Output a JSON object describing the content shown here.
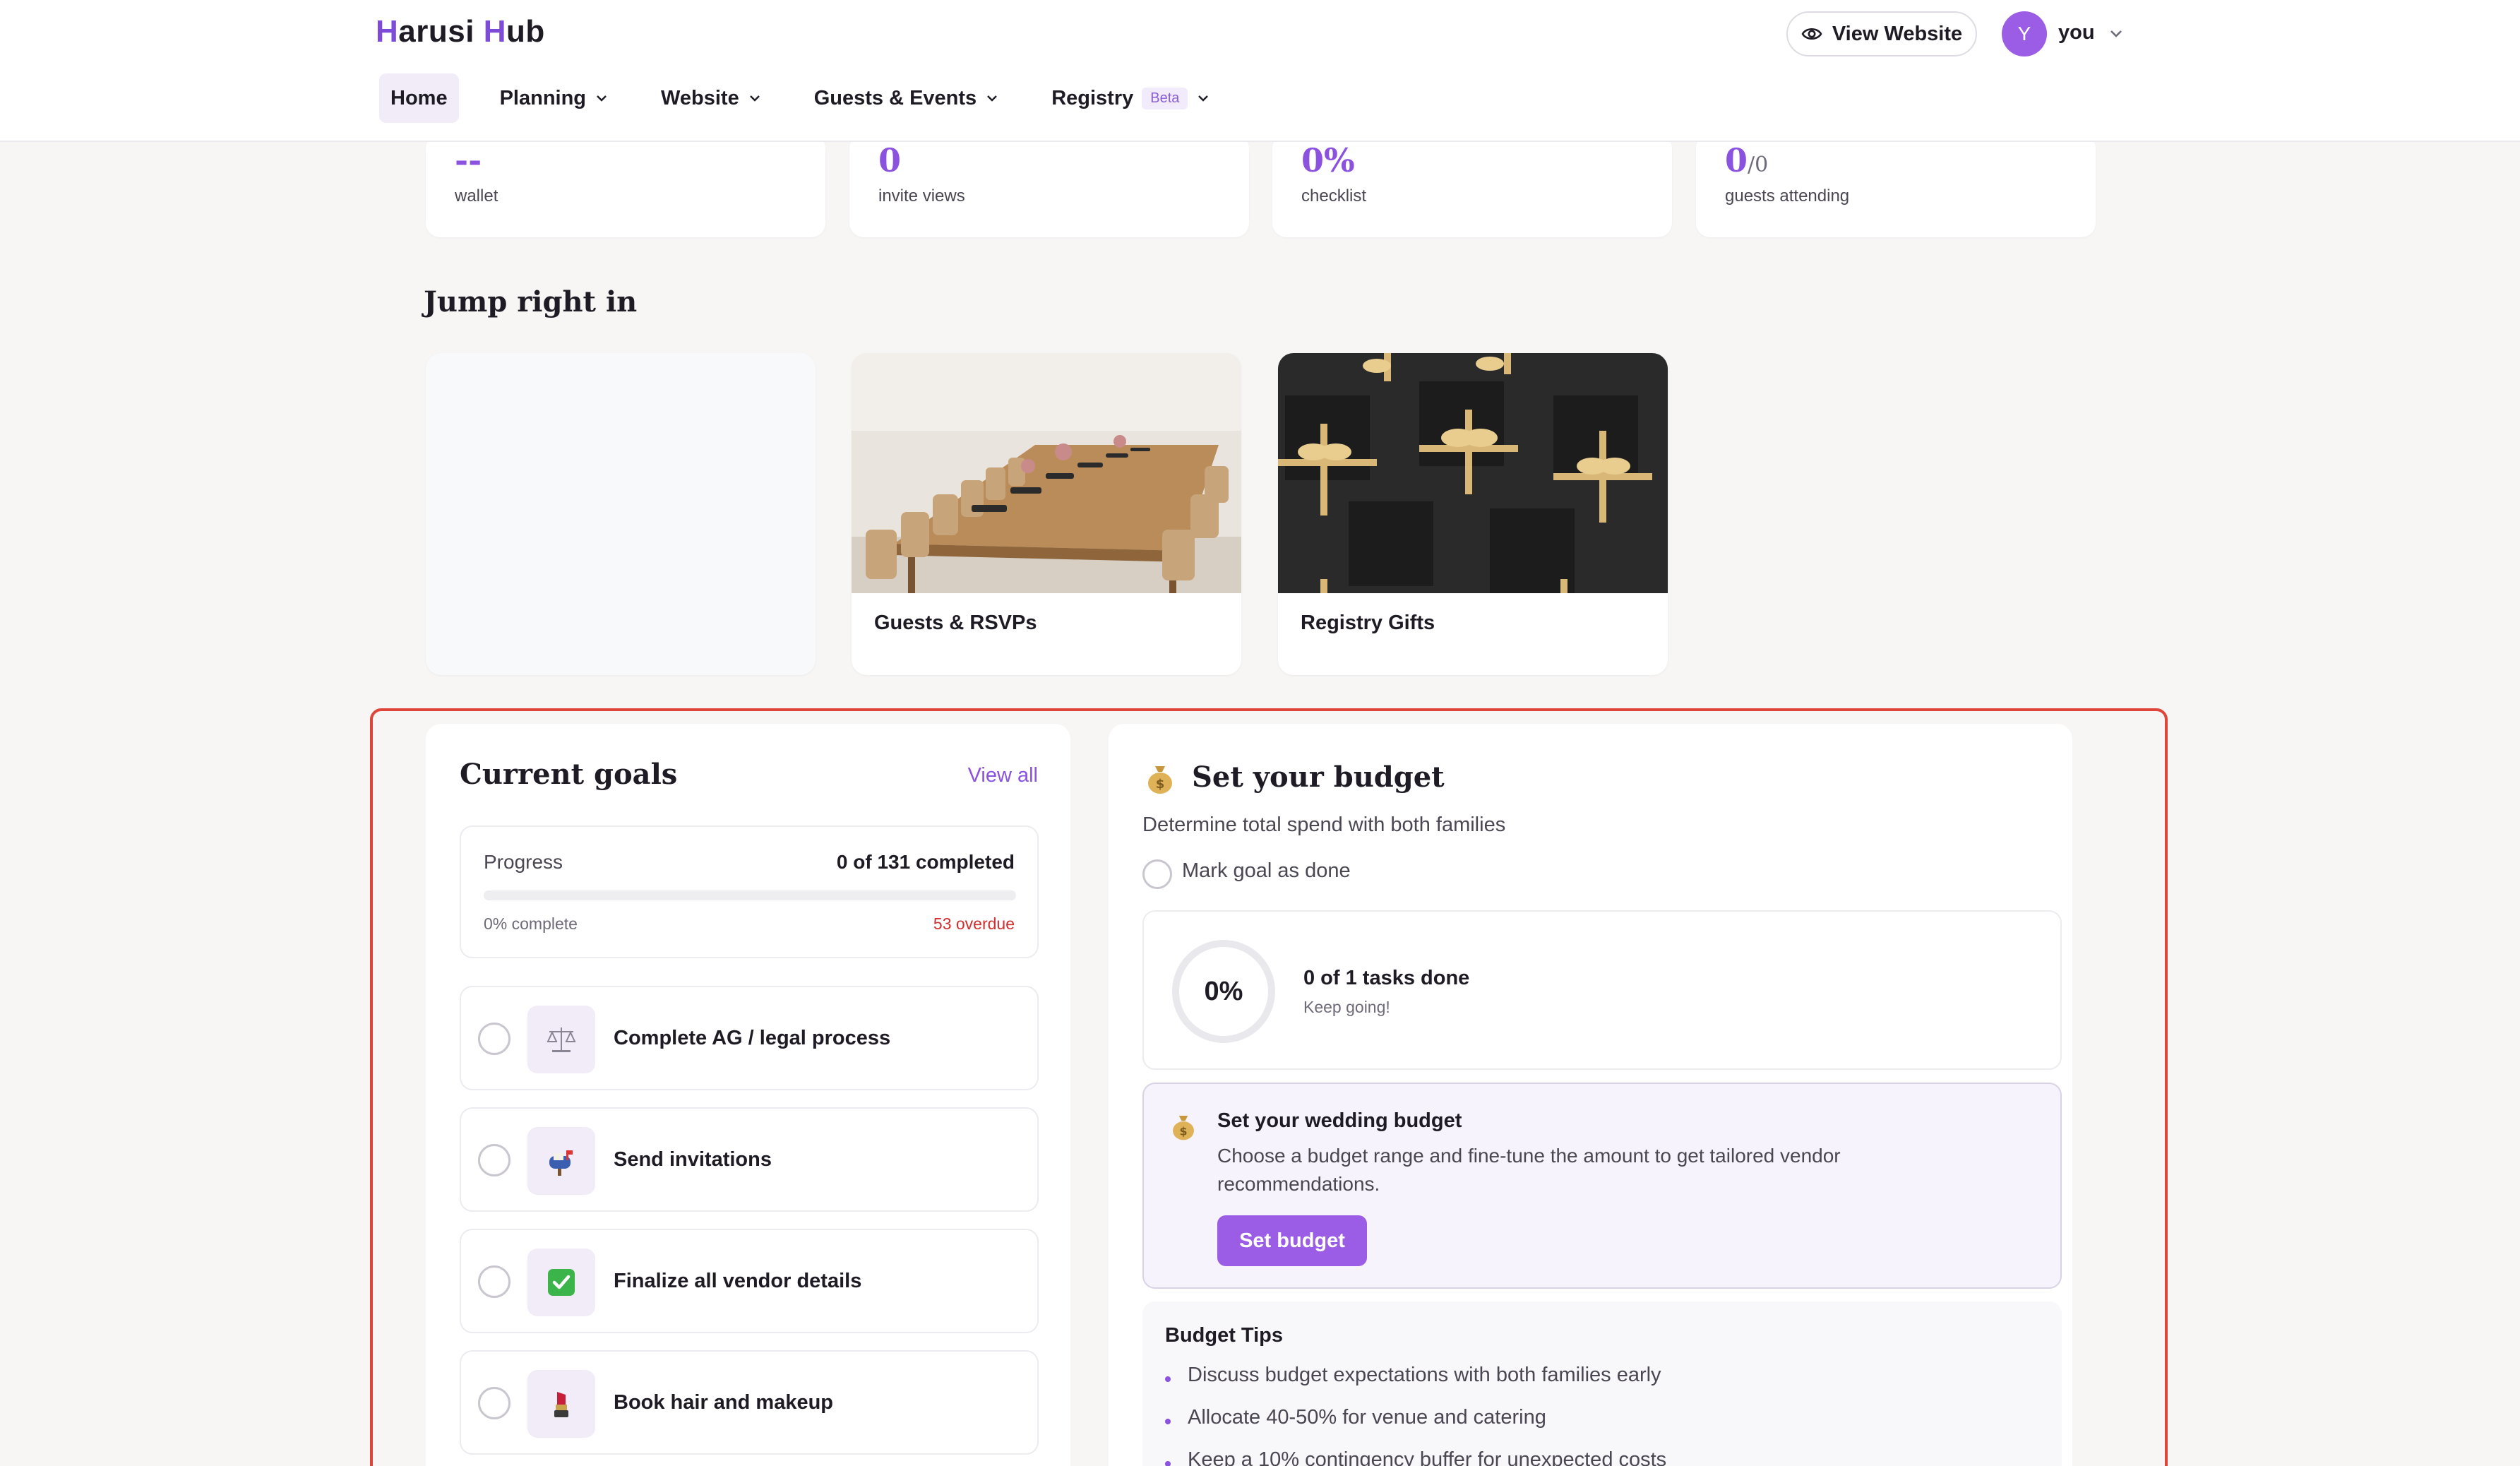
{
  "header": {
    "logo_left": "arusi",
    "logo_right": "ub",
    "view_website": "View Website",
    "user_initial": "Y",
    "user_name": "you"
  },
  "nav": {
    "home": "Home",
    "planning": "Planning",
    "website": "Website",
    "guests_events": "Guests & Events",
    "registry": "Registry",
    "registry_badge": "Beta"
  },
  "stats": [
    {
      "value": "--",
      "label": "wallet"
    },
    {
      "value": "0",
      "label": "invite views"
    },
    {
      "value": "0%",
      "label": "checklist"
    },
    {
      "value": "0",
      "value_suffix": "/0",
      "label": "guests attending"
    }
  ],
  "jump": {
    "title": "Jump right in",
    "tiles": [
      {
        "caption": "Guests & RSVPs"
      },
      {
        "caption": "Registry Gifts"
      }
    ]
  },
  "goals": {
    "title": "Current goals",
    "view_all": "View all",
    "progress_label": "Progress",
    "completed": "0 of 131 completed",
    "percent_complete": "0% complete",
    "overdue": "53 overdue",
    "progress_fraction": 0,
    "items": [
      {
        "title": "Complete AG / legal process",
        "icon": "scales-icon"
      },
      {
        "title": "Send invitations",
        "icon": "mailbox-icon"
      },
      {
        "title": "Finalize all vendor details",
        "icon": "check-icon"
      },
      {
        "title": "Book hair and makeup",
        "icon": "lipstick-icon"
      }
    ]
  },
  "budget": {
    "title": "Set your budget",
    "subtitle": "Determine total spend with both families",
    "mark_done": "Mark goal as done",
    "ring_percent": "0%",
    "tasks_done": "0 of 1 tasks done",
    "keep_going": "Keep going!",
    "wedding_title": "Set your wedding budget",
    "wedding_desc": "Choose a budget range and fine-tune the amount to get tailored vendor recommendations.",
    "set_button": "Set budget",
    "tips_title": "Budget Tips",
    "tips": [
      "Discuss budget expectations with both families early",
      "Allocate 40-50% for venue and catering",
      "Keep a 10% contingency buffer for unexpected costs"
    ]
  },
  "colors": {
    "accent": "#9b5de5",
    "accent_text": "#8b52e0",
    "overdue": "#d22e2e",
    "highlight_frame": "#e0453a"
  }
}
